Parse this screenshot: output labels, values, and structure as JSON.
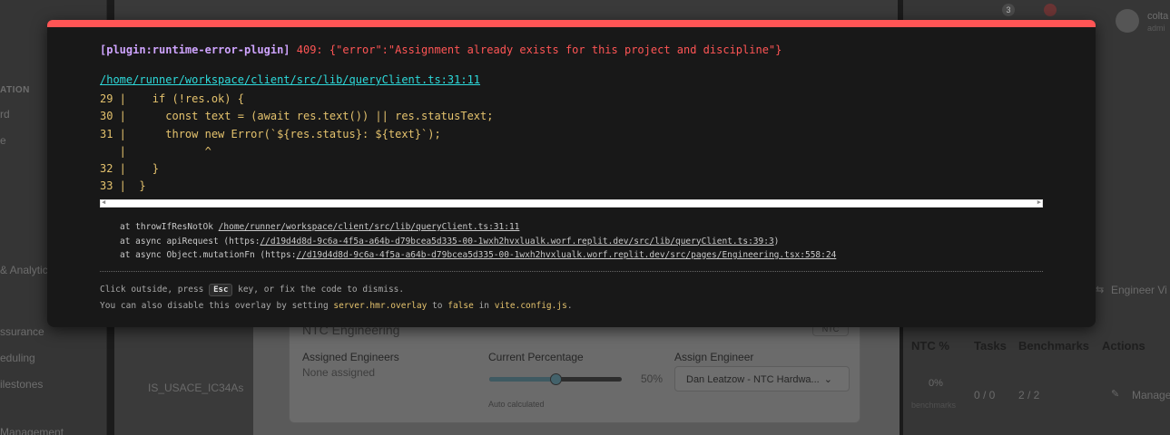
{
  "background": {
    "sidebar": {
      "section_label": "ATION",
      "items": [
        "rd",
        "e",
        "& Analytic",
        "ssurance",
        "eduling",
        "ilestones",
        "Management"
      ]
    },
    "topbar": {
      "notification_count": "3",
      "user_name": "colta",
      "user_role": "admi"
    },
    "right_panel": {
      "view_toggle": "Engineer Vi",
      "columns": [
        "NTC %",
        "Tasks",
        "Benchmarks",
        "Actions"
      ],
      "row": {
        "pct": "0%",
        "pct_sub": "benchmarks",
        "tasks": "0 / 0",
        "benchmarks": "2 / 2",
        "action": "Manage"
      }
    },
    "main_row_text": "IS_USACE_IC34As",
    "dialog": {
      "card_title": "NTC Engineering",
      "badge": "NTC",
      "assigned_label": "Assigned Engineers",
      "assigned_value": "None assigned",
      "percentage_label": "Current Percentage",
      "percentage_value": "50%",
      "percentage_fraction": 0.5,
      "percentage_note": "Auto calculated",
      "assign_label": "Assign Engineer",
      "assign_select": "Dan Leatzow - NTC Hardwa..."
    }
  },
  "overlay": {
    "plugin": "[plugin:runtime-error-plugin]",
    "message": "409: {\"error\":\"Assignment already exists for this project and discipline\"}",
    "file": "/home/runner/workspace/client/src/lib/queryClient.ts:31:11",
    "frame_lines": [
      "29 |    if (!res.ok) {",
      "30 |      const text = (await res.text()) || res.statusText;",
      "31 |      throw new Error(`${res.status}: ${text}`);",
      "   |            ^",
      "32 |    }",
      "33 |  }"
    ],
    "stack": {
      "line1_prefix": "at throwIfResNotOk ",
      "line1_link": "/home/runner/workspace/client/src/lib/queryClient.ts:31:11",
      "line2_prefix": "at async apiRequest (https:",
      "line2_link": "//d19d4d8d-9c6a-4f5a-a64b-d79bcea5d335-00-1wxh2hvxlualk.worf.replit.dev/src/lib/queryClient.ts:39:3",
      "line2_suffix": ")",
      "line3_prefix": "at async Object.mutationFn (https:",
      "line3_link": "//d19d4d8d-9c6a-4f5a-a64b-d79bcea5d335-00-1wxh2hvxlualk.worf.replit.dev/src/pages/Engineering.tsx:558:24"
    },
    "tip1_before": "Click outside, press ",
    "tip1_key": "Esc",
    "tip1_after": " key, or fix the code to dismiss.",
    "tip2_before": "You can also disable this overlay by setting ",
    "tip2_code1": "server.hmr.overlay",
    "tip2_mid": " to ",
    "tip2_code2": "false",
    "tip2_in": " in ",
    "tip2_code3": "vite.config.js",
    "tip2_end": "."
  }
}
